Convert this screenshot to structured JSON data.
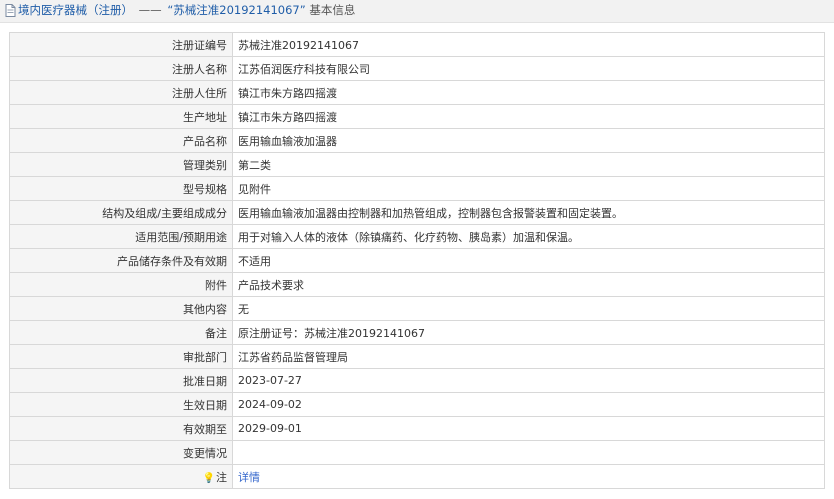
{
  "header": {
    "category": "境内医疗器械",
    "category_note": "（注册）",
    "separator": "——",
    "record_title": "“苏械注准20192141067”",
    "record_suffix": "基本信息"
  },
  "rows": [
    {
      "label": "注册证编号",
      "value": "苏械注准20192141067"
    },
    {
      "label": "注册人名称",
      "value": "江苏佰润医疗科技有限公司"
    },
    {
      "label": "注册人住所",
      "value": "镇江市朱方路四摇渡"
    },
    {
      "label": "生产地址",
      "value": "镇江市朱方路四摇渡"
    },
    {
      "label": "产品名称",
      "value": "医用输血输液加温器"
    },
    {
      "label": "管理类别",
      "value": "第二类"
    },
    {
      "label": "型号规格",
      "value": "见附件"
    },
    {
      "label": "结构及组成/主要组成成分",
      "value": "医用输血输液加温器由控制器和加热管组成，控制器包含报警装置和固定装置。"
    },
    {
      "label": "适用范围/预期用途",
      "value": "用于对输入人体的液体（除镇痛药、化疗药物、胰岛素）加温和保温。"
    },
    {
      "label": "产品储存条件及有效期",
      "value": "不适用"
    },
    {
      "label": "附件",
      "value": "产品技术要求"
    },
    {
      "label": "其他内容",
      "value": "无"
    },
    {
      "label": "备注",
      "value": "原注册证号：苏械注准20192141067"
    },
    {
      "label": "审批部门",
      "value": "江苏省药品监督管理局"
    },
    {
      "label": "批准日期",
      "value": "2023-07-27"
    },
    {
      "label": "生效日期",
      "value": "2024-09-02"
    },
    {
      "label": "有效期至",
      "value": "2029-09-01"
    },
    {
      "label": "变更情况",
      "value": ""
    }
  ],
  "note_row": {
    "icon": "lightbulb-icon",
    "label": "注",
    "link_text": "详情"
  },
  "colors": {
    "title": "#1f5da8",
    "link": "#3366cc",
    "label_bg": "#f5f5f5",
    "border": "#d8d8d8"
  }
}
